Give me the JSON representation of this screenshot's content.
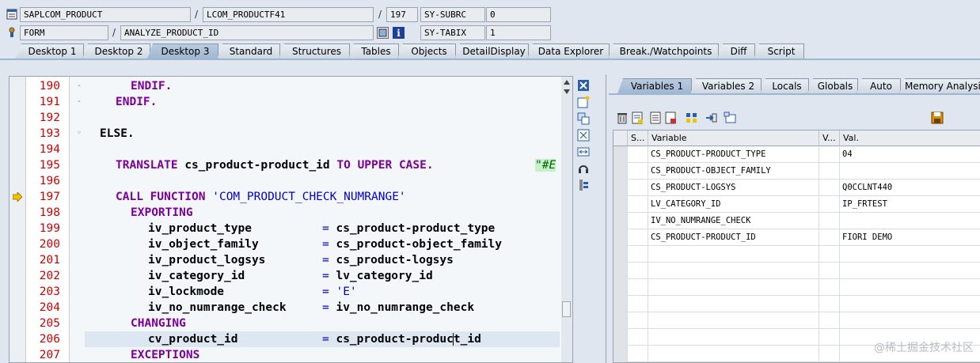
{
  "header": {
    "row1": {
      "program": "SAPLCOM_PRODUCT",
      "include": "LCOM_PRODUCTF41",
      "line": "197",
      "sysvar": "SY-SUBRC",
      "sysval": "0"
    },
    "row2": {
      "event_type": "FORM",
      "event": "ANALYZE_PRODUCT_ID",
      "sysvar": "SY-TABIX",
      "sysval": "1"
    },
    "slash": "/"
  },
  "tabs": [
    "Desktop 1",
    "Desktop 2",
    "Desktop 3",
    "Standard",
    "Structures",
    "Tables",
    "Objects",
    "DetailDisplay",
    "Data Explorer",
    "Break./Watchpoints",
    "Diff",
    "Script"
  ],
  "active_tab": "Desktop 3",
  "editor": {
    "line_numbers": [
      "190",
      "191",
      "192",
      "193",
      "194",
      "195",
      "196",
      "197",
      "198",
      "199",
      "200",
      "201",
      "202",
      "203",
      "204",
      "205",
      "206",
      "207"
    ],
    "lines": {
      "l190": "ENDIF.",
      "l191": "ENDIF.",
      "l193": "ELSE.",
      "l195_kw1": "TRANSLATE",
      "l195_id": "cs_product-product_id",
      "l195_kw2": "TO UPPER CASE.",
      "l195_cm": "\"#E",
      "l197_kw": "CALL FUNCTION",
      "l197_str": "'COM_PRODUCT_CHECK_NUMRANGE'",
      "l198": "EXPORTING",
      "l199_p": "iv_product_type",
      "l199_v": "cs_product-product_type",
      "l200_p": "iv_object_family",
      "l200_v": "cs_product-object_family",
      "l201_p": "iv_product_logsys",
      "l201_v": "cs_product-logsys",
      "l202_p": "iv_category_id",
      "l202_v": "lv_category_id",
      "l203_p": "iv_lockmode",
      "l203_v": "'E'",
      "l204_p": "iv_no_numrange_check",
      "l204_v": "iv_no_numrange_check",
      "l205": "CHANGING",
      "l206_p": "cv_product_id",
      "l206_v1": "cs_product-produc",
      "l206_v2": "t_id",
      "l207": "EXCEPTIONS",
      "eq": "="
    },
    "current_line": "197"
  },
  "right_panel": {
    "tabs": [
      "Variables 1",
      "Variables 2",
      "Locals",
      "Globals",
      "Auto",
      "Memory Analysis"
    ],
    "active_tab": "Variables 1",
    "columns": [
      "S...",
      "Variable",
      "V...",
      "Val."
    ],
    "rows": [
      {
        "variable": "CS_PRODUCT-PRODUCT_TYPE",
        "value": "04"
      },
      {
        "variable": "CS_PRODUCT-OBJECT_FAMILY",
        "value": ""
      },
      {
        "variable": "CS_PRODUCT-LOGSYS",
        "value": "Q0CCLNT440"
      },
      {
        "variable": "LV_CATEGORY_ID",
        "value": "IP_FRTEST"
      },
      {
        "variable": "IV_NO_NUMRANGE_CHECK",
        "value": ""
      },
      {
        "variable": "CS_PRODUCT-PRODUCT_ID",
        "value": "FIORI DEMO"
      }
    ]
  },
  "watermark": "@稀土掘金技术社区",
  "colors": {
    "keyword": "#7b0099",
    "string": "#0000cc",
    "line_number": "#cc0000",
    "active_tab": "#9fb6d2"
  }
}
